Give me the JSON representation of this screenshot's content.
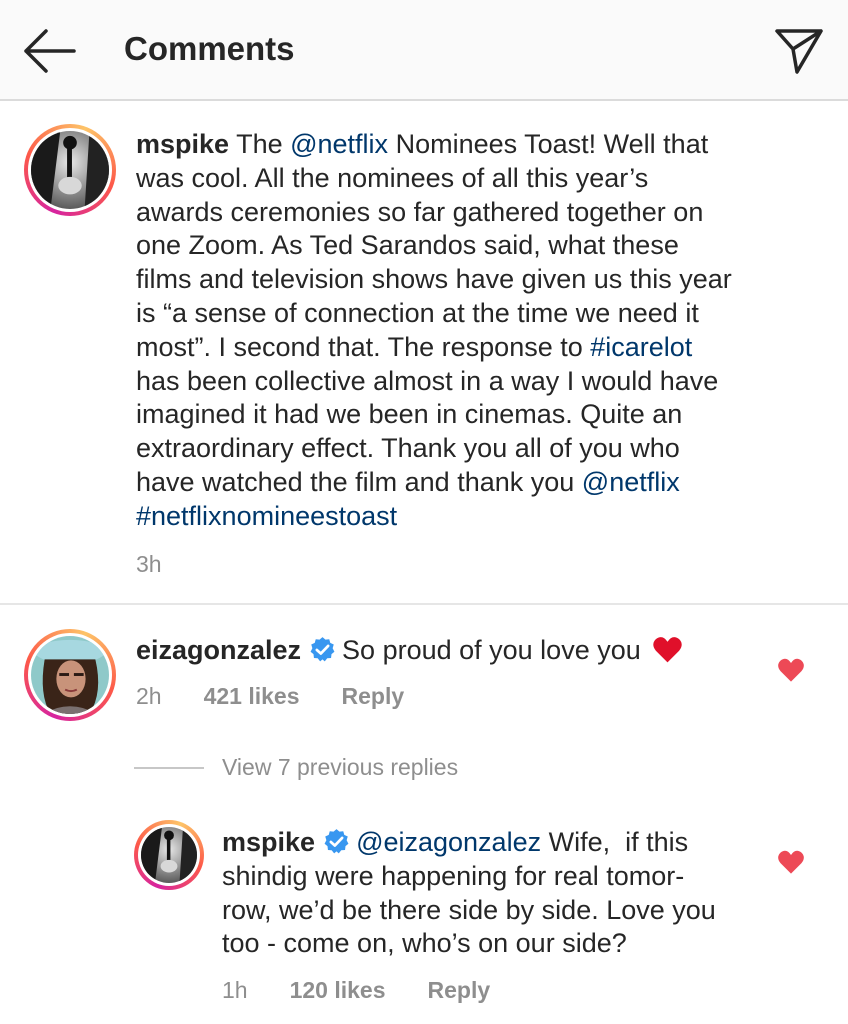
{
  "header": {
    "title": "Comments"
  },
  "caption": {
    "username": "mspike",
    "lines": [
      [
        "The ",
        "@netflix",
        " Nominees Toast! Well that"
      ],
      [
        "was cool. All the nominees of all this year’s"
      ],
      [
        "awards ceremonies so far gathered together on"
      ],
      [
        "one Zoom. As Ted Sarandos said, what these"
      ],
      [
        "films and television shows have given us this year"
      ],
      [
        "is “a sense of connection at the time we need it"
      ],
      [
        "most”. I second that. The response to ",
        "#icarelot"
      ],
      [
        "has been collective almost in a way I would have"
      ],
      [
        "imagined it had we been in cinemas. Quite an"
      ],
      [
        "extraordinary effect. Thank you all of you who"
      ],
      [
        "have watched the film and thank you ",
        "@netflix"
      ],
      [
        "#netflixnomineestoast"
      ]
    ],
    "time": "3h"
  },
  "comment": {
    "username": "eizagonzalez",
    "text": "So proud of you love you",
    "emoji": "❤️",
    "time": "2h",
    "likes": "421 likes",
    "reply_label": "Reply"
  },
  "view_replies": "View 7 previous replies",
  "reply": {
    "username": "mspike",
    "mention": "@eizagonzalez",
    "lines": [
      " Wife,  if this",
      "shindig were happening for real tomor-",
      "row, we’d be there side by side. Love you",
      "too - come on, who’s on our side?"
    ],
    "time": "1h",
    "likes": "120 likes",
    "reply_label": "Reply"
  },
  "colors": {
    "link": "#00376b",
    "heart": "#ed4956",
    "verified": "#3897f0",
    "muted": "#8e8e8e"
  },
  "icons": {
    "back": "arrow-left-icon",
    "share": "paper-plane-icon",
    "like": "heart-icon",
    "verified": "verified-badge-icon"
  }
}
